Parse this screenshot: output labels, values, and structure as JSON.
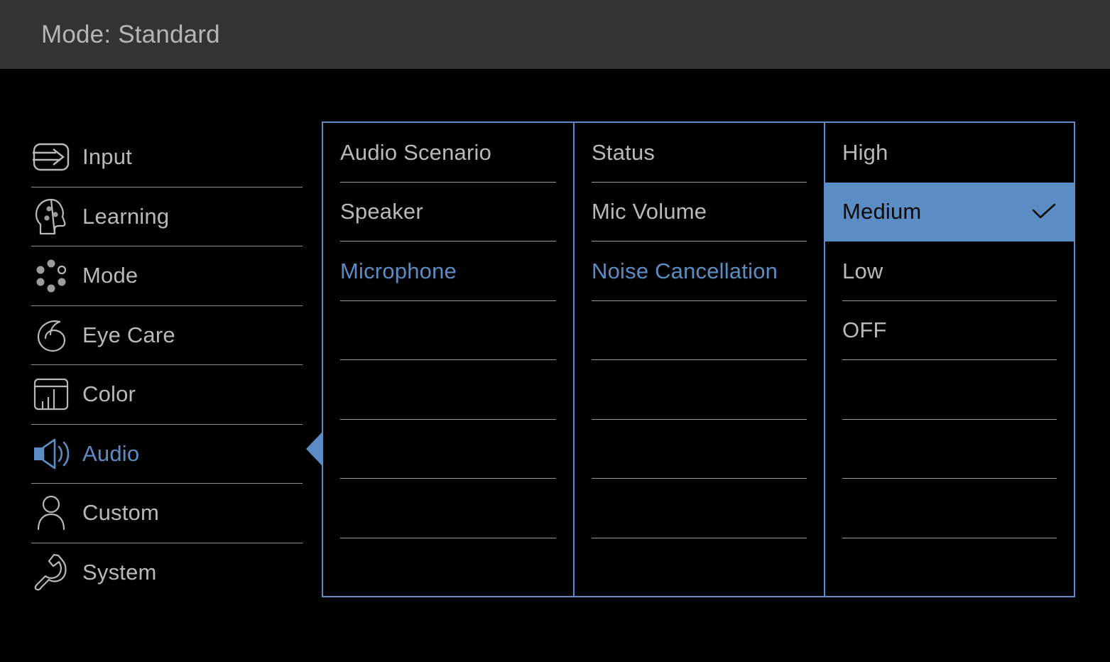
{
  "header": {
    "title": "Mode: Standard",
    "bg_color": "#333333",
    "text_color": "#b6b6b6"
  },
  "theme": {
    "accent": "#5b8cc4",
    "text": "#b9b9b9",
    "divider": "#9a9a9a",
    "background": "#000000"
  },
  "sidebar": {
    "items": [
      {
        "label": "Input",
        "icon": "input-arrow-icon",
        "active": false
      },
      {
        "label": "Learning",
        "icon": "head-brain-icon",
        "active": false
      },
      {
        "label": "Mode",
        "icon": "dots-circle-icon",
        "active": false
      },
      {
        "label": "Eye Care",
        "icon": "eye-icon",
        "active": false
      },
      {
        "label": "Color",
        "icon": "color-monitor-icon",
        "active": false
      },
      {
        "label": "Audio",
        "icon": "speaker-icon",
        "active": true
      },
      {
        "label": "Custom",
        "icon": "person-icon",
        "active": false
      },
      {
        "label": "System",
        "icon": "wrench-icon",
        "active": false
      }
    ],
    "selection_arrow": "left-triangle-icon"
  },
  "panel": {
    "columns": [
      {
        "name": "audio-menu",
        "rows": [
          {
            "label": "Audio Scenario",
            "state": "normal"
          },
          {
            "label": "Speaker",
            "state": "normal"
          },
          {
            "label": "Microphone",
            "state": "selected"
          },
          {
            "label": "",
            "state": "empty"
          },
          {
            "label": "",
            "state": "empty"
          },
          {
            "label": "",
            "state": "empty"
          },
          {
            "label": "",
            "state": "empty"
          },
          {
            "label": "",
            "state": "empty"
          }
        ]
      },
      {
        "name": "microphone-menu",
        "rows": [
          {
            "label": "Status",
            "state": "normal"
          },
          {
            "label": "Mic Volume",
            "state": "normal"
          },
          {
            "label": "Noise Cancellation",
            "state": "selected"
          },
          {
            "label": "",
            "state": "empty"
          },
          {
            "label": "",
            "state": "empty"
          },
          {
            "label": "",
            "state": "empty"
          },
          {
            "label": "",
            "state": "empty"
          },
          {
            "label": "",
            "state": "empty"
          }
        ]
      },
      {
        "name": "noise-cancellation-options",
        "rows": [
          {
            "label": "High",
            "state": "normal"
          },
          {
            "label": "Medium",
            "state": "highlight",
            "checked": true
          },
          {
            "label": "Low",
            "state": "normal"
          },
          {
            "label": "OFF",
            "state": "normal"
          },
          {
            "label": "",
            "state": "empty"
          },
          {
            "label": "",
            "state": "empty"
          },
          {
            "label": "",
            "state": "empty"
          },
          {
            "label": "",
            "state": "empty"
          }
        ]
      }
    ]
  }
}
